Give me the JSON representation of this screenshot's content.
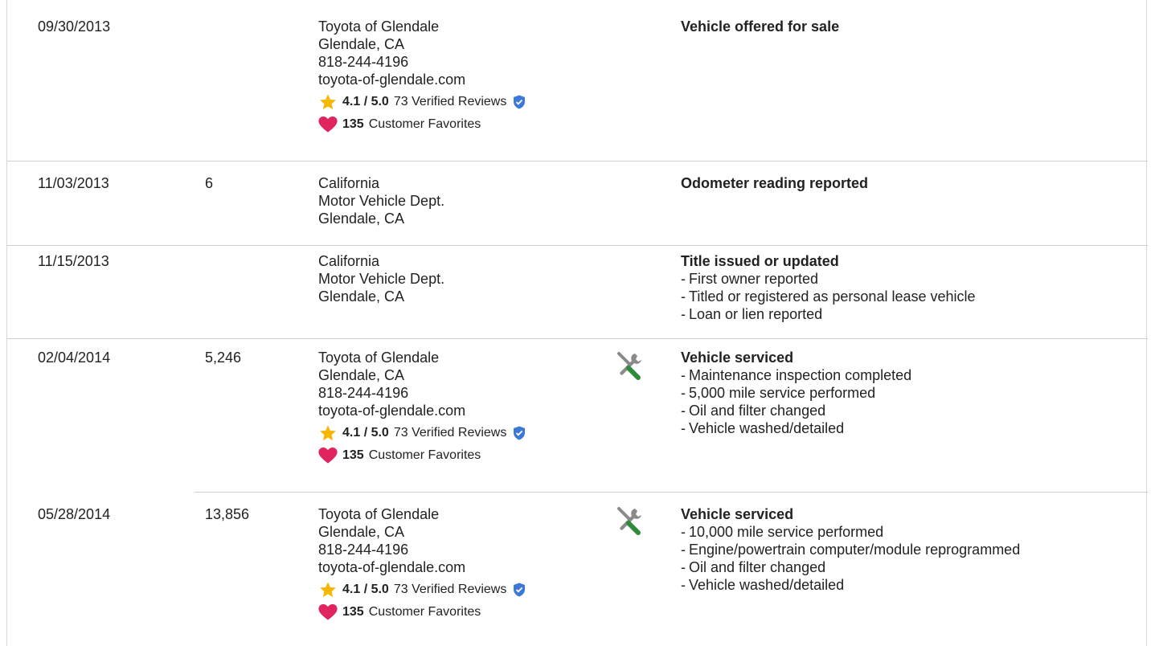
{
  "records": [
    {
      "date": "09/30/2013",
      "mileage": "",
      "source": {
        "lines": [
          "Toyota of Glendale",
          "Glendale, CA",
          "818-244-4196",
          "toyota-of-glendale.com"
        ],
        "rating": "4.1 / 5.0",
        "reviews_label": "73 Verified Reviews",
        "favorites_count": "135",
        "favorites_label": "Customer Favorites"
      },
      "service_icon": false,
      "comment_title": "Vehicle offered for sale",
      "comment_items": []
    },
    {
      "date": "11/03/2013",
      "mileage": "6",
      "source": {
        "lines": [
          "California",
          "Motor Vehicle Dept.",
          "Glendale, CA"
        ]
      },
      "service_icon": false,
      "comment_title": "Odometer reading reported",
      "comment_items": []
    },
    {
      "date": "11/15/2013",
      "mileage": "",
      "source": {
        "lines": [
          "California",
          "Motor Vehicle Dept.",
          "Glendale, CA"
        ]
      },
      "service_icon": false,
      "comment_title": "Title issued or updated",
      "comment_items": [
        "First owner reported",
        "Titled or registered as personal lease vehicle",
        "Loan or lien reported"
      ]
    },
    {
      "date": "02/04/2014",
      "mileage": "5,246",
      "source": {
        "lines": [
          "Toyota of Glendale",
          "Glendale, CA",
          "818-244-4196",
          "toyota-of-glendale.com"
        ],
        "rating": "4.1 / 5.0",
        "reviews_label": "73 Verified Reviews",
        "favorites_count": "135",
        "favorites_label": "Customer Favorites"
      },
      "service_icon": true,
      "comment_title": "Vehicle serviced",
      "comment_items": [
        "Maintenance inspection completed",
        "5,000 mile service performed",
        "Oil and filter changed",
        "Vehicle washed/detailed"
      ]
    },
    {
      "date": "05/28/2014",
      "mileage": "13,856",
      "source": {
        "lines": [
          "Toyota of Glendale",
          "Glendale, CA",
          "818-244-4196",
          "toyota-of-glendale.com"
        ],
        "rating": "4.1 / 5.0",
        "reviews_label": "73 Verified Reviews",
        "favorites_count": "135",
        "favorites_label": "Customer Favorites"
      },
      "service_icon": true,
      "comment_title": "Vehicle serviced",
      "comment_items": [
        "10,000 mile service performed",
        "Engine/powertrain computer/module reprogrammed",
        "Oil and filter changed",
        "Vehicle washed/detailed"
      ]
    }
  ],
  "colors": {
    "star": "#f5b700",
    "heart": "#e0245e",
    "shield": "#3b78d8",
    "wrench_handle": "#2e8b3a",
    "tool": "#8a8a8a",
    "divider": "#cfcfcf"
  }
}
